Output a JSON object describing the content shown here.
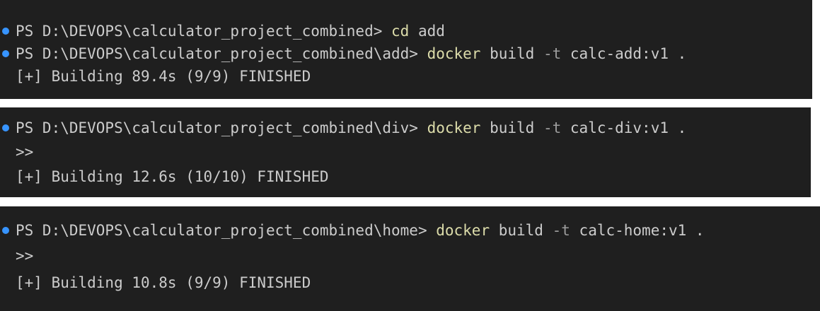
{
  "terminal": {
    "colors": {
      "background": "#1f1f1f",
      "text": "#cccccc",
      "command": "#dcdcaa",
      "flag": "#9d9d9d",
      "bullet": "#3794ff"
    },
    "panels": [
      {
        "lines": [
          {
            "prompt": "PS D:\\DEVOPS\\calculator_project_combined> ",
            "command": "cd",
            "rest": " add"
          },
          {
            "prompt": "PS D:\\DEVOPS\\calculator_project_combined\\add> ",
            "command": "docker",
            "args1": " build ",
            "flag": "-t",
            "args2": " calc-add:v1 ."
          },
          {
            "output": "[+] Building 89.4s (9/9) FINISHED"
          }
        ]
      },
      {
        "lines": [
          {
            "prompt": "PS D:\\DEVOPS\\calculator_project_combined\\div> ",
            "command": "docker",
            "args1": " build ",
            "flag": "-t",
            "args2": " calc-div:v1 ."
          },
          {
            "output": ">>"
          },
          {
            "output": "[+] Building 12.6s (10/10) FINISHED"
          }
        ]
      },
      {
        "lines": [
          {
            "prompt": "PS D:\\DEVOPS\\calculator_project_combined\\home> ",
            "command": "docker",
            "args1": " build ",
            "flag": "-t",
            "args2": " calc-home:v1 ."
          },
          {
            "output": ">>"
          },
          {
            "output": "[+] Building 10.8s (9/9) FINISHED"
          }
        ]
      }
    ]
  }
}
